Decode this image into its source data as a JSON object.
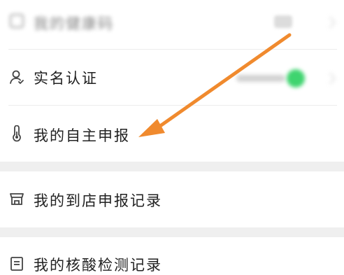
{
  "menu": {
    "items": [
      {
        "label": "我的健康码",
        "icon": "qr-code-icon"
      },
      {
        "label": "实名认证",
        "icon": "person-icon"
      },
      {
        "label": "我的自主申报",
        "icon": "thermometer-icon"
      },
      {
        "label": "我的到店申报记录",
        "icon": "store-icon"
      },
      {
        "label": "我的核酸检测记录",
        "icon": "document-list-icon"
      }
    ]
  },
  "colors": {
    "arrow": "#f08a2e",
    "toggle_on": "#3fd46f",
    "divider": "#efefef"
  }
}
